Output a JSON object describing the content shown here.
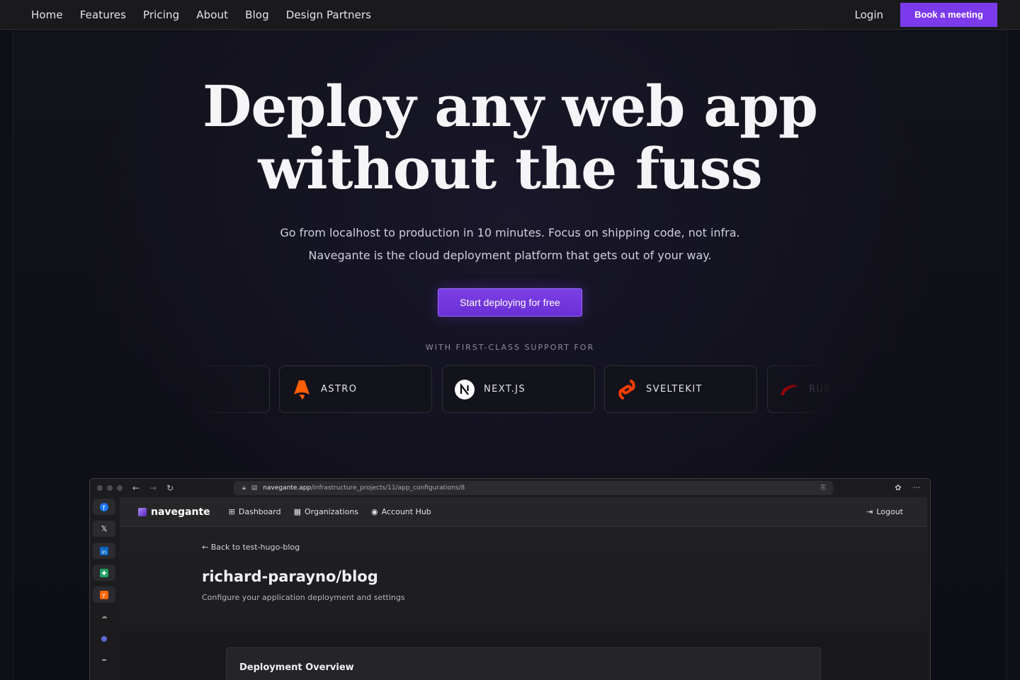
{
  "nav": {
    "links": [
      "Home",
      "Features",
      "Pricing",
      "About",
      "Blog",
      "Design Partners"
    ],
    "login": "Login",
    "book": "Book a meeting"
  },
  "hero": {
    "title_line1": "Deploy any web app",
    "title_line2": "without the fuss",
    "sub_line1": "Go from localhost to production in 10 minutes. Focus on shipping code, not infra.",
    "sub_line2": "Navegante is the cloud deployment platform that gets out of your way.",
    "cta": "Start deploying for free",
    "support_label": "WITH FIRST-CLASS SUPPORT FOR"
  },
  "frameworks": [
    {
      "label": "",
      "icon": "framework-icon"
    },
    {
      "label": "ASTRO",
      "icon": "astro-icon"
    },
    {
      "label": "NEXT.JS",
      "icon": "nextjs-icon"
    },
    {
      "label": "SVELTEKIT",
      "icon": "svelte-icon"
    },
    {
      "label": "RUBY",
      "icon": "rails-icon"
    }
  ],
  "browser": {
    "url_host": "navegante.app",
    "url_path": "/infrastructure_projects/11/app_configurations/8",
    "side_icons": [
      "facebook-icon",
      "x-icon",
      "linkedin-icon",
      "sheets-icon",
      "hackernews-icon",
      "cloud-icon",
      "planet-icon",
      "dash-icon"
    ],
    "app": {
      "logo": "navegante",
      "links": [
        "Dashboard",
        "Organizations",
        "Account Hub"
      ],
      "logout": "Logout",
      "back": "Back to test-hugo-blog",
      "project_title": "richard-parayno/blog",
      "project_sub": "Configure your application deployment and settings",
      "overview": "Deployment Overview"
    }
  },
  "colors": {
    "accent": "#7c3aed",
    "background": "#0f0f17"
  }
}
